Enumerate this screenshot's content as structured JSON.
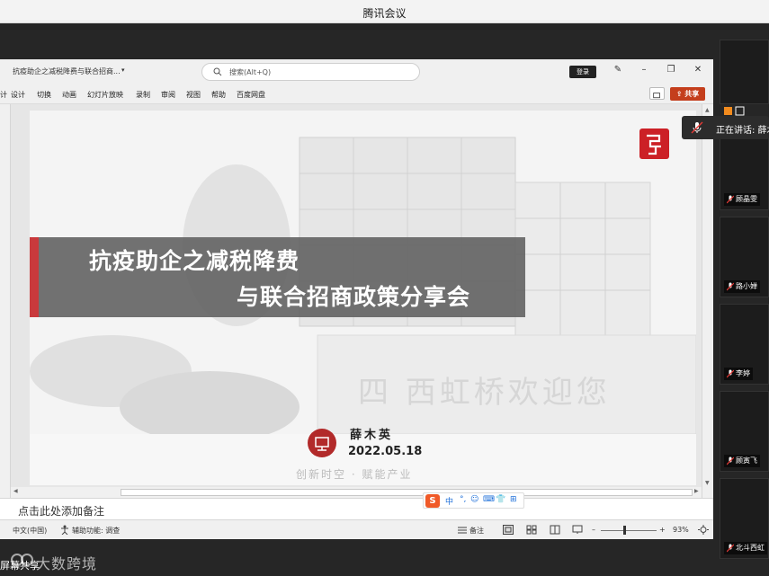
{
  "meeting": {
    "app_title": "腾讯会议",
    "speaking_label": "正在讲话: 薛木",
    "sharer_label": "屏幕共享",
    "brand_watermark": "大数跨境"
  },
  "participants": [
    {
      "name": "顾晶雯"
    },
    {
      "name": "路小婵"
    },
    {
      "name": "李婷"
    },
    {
      "name": "顾寅飞"
    },
    {
      "name": "北斗西虹"
    }
  ],
  "ppt": {
    "doc_title": "抗疫助企之减税降费与联合招商...",
    "search_placeholder": "搜索(Alt+Q)",
    "login_label": "登录",
    "share_label": "共享",
    "ribbon_tabs": [
      "计",
      "设计",
      "切换",
      "动画",
      "幻灯片放映",
      "录制",
      "审阅",
      "视图",
      "帮助",
      "百度网盘"
    ],
    "notes_placeholder": "点击此处添加备注",
    "status": {
      "language": "中文(中国)",
      "accessibility": "辅助功能: 调查",
      "notes_btn": "备注",
      "zoom": "93%"
    }
  },
  "slide": {
    "title_line1": "抗疫助企之减税降费",
    "title_line2": "与联合招商政策分享会",
    "speaker": "薛木英",
    "date": "2022.05.18",
    "slogan": "创新时空 · 赋能产业",
    "background_sign": "四 西虹桥欢迎您"
  },
  "ime": {
    "items": [
      "中",
      "°,",
      "☺",
      "⌨",
      "👕",
      "⊞"
    ]
  },
  "colors": {
    "accent_red": "#c9393c",
    "share_orange": "#c43e1c",
    "meeting_dark": "#262626"
  }
}
